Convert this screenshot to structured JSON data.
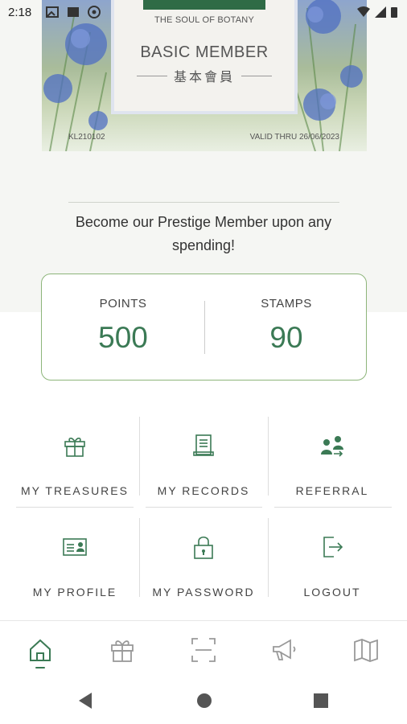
{
  "status_bar": {
    "time": "2:18"
  },
  "card": {
    "slogan": "THE SOUL OF BOTANY",
    "tier": "BASIC MEMBER",
    "tier_cn": "基本會員",
    "member_id": "KL210102",
    "valid_thru": "VALID THRU 26/06/2023"
  },
  "promo_text": "Become our Prestige Member upon any spending!",
  "stats": {
    "points_label": "POINTS",
    "points_value": "500",
    "stamps_label": "STAMPS",
    "stamps_value": "90"
  },
  "menu": [
    {
      "label": "MY TREASURES",
      "icon": "gift-icon"
    },
    {
      "label": "MY RECORDS",
      "icon": "receipt-icon"
    },
    {
      "label": "REFERRAL",
      "icon": "referral-icon"
    },
    {
      "label": "MY PROFILE",
      "icon": "id-card-icon"
    },
    {
      "label": "MY PASSWORD",
      "icon": "lock-icon"
    },
    {
      "label": "LOGOUT",
      "icon": "logout-icon"
    }
  ],
  "bottom_nav": [
    {
      "icon": "home-icon",
      "active": true
    },
    {
      "icon": "gift-icon",
      "active": false
    },
    {
      "icon": "scan-icon",
      "active": false
    },
    {
      "icon": "megaphone-icon",
      "active": false
    },
    {
      "icon": "map-icon",
      "active": false
    }
  ],
  "colors": {
    "accent": "#3b7a55",
    "border": "#8db57a",
    "brand_bar": "#2f6b46"
  }
}
